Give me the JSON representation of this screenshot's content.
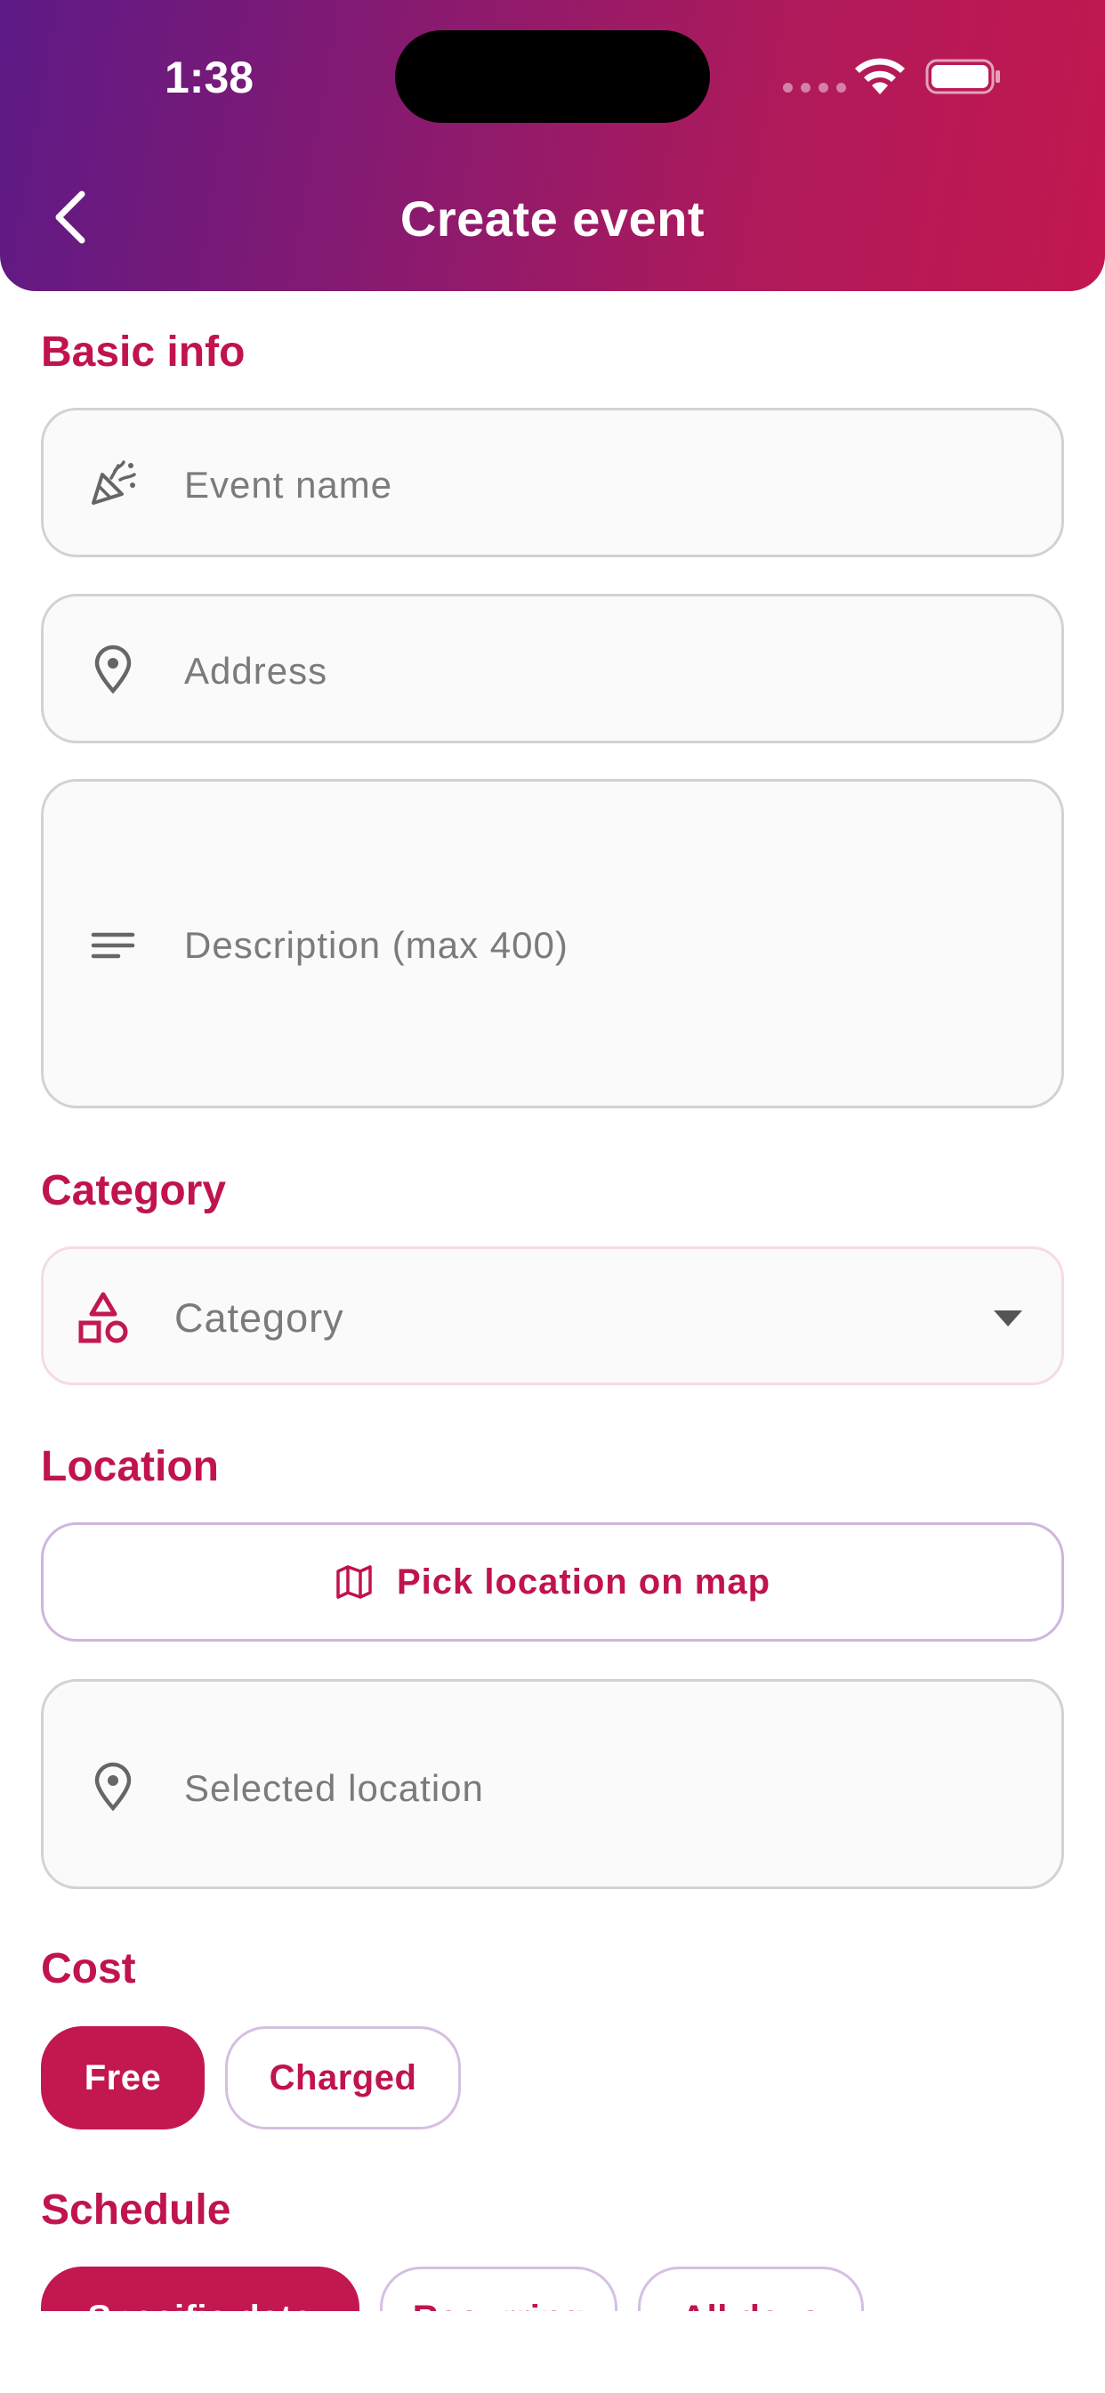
{
  "status_bar": {
    "time": "1:38"
  },
  "header": {
    "title": "Create event"
  },
  "sections": {
    "basic_info": "Basic info",
    "category": "Category",
    "location": "Location",
    "cost": "Cost",
    "schedule": "Schedule"
  },
  "fields": {
    "event_name": {
      "placeholder": "Event name",
      "icon": "party-popper-icon"
    },
    "address": {
      "placeholder": "Address",
      "icon": "location-pin-icon"
    },
    "description": {
      "placeholder": "Description (max 400)",
      "icon": "notes-lines-icon"
    },
    "category": {
      "placeholder": "Category",
      "icon": "shapes-icon"
    },
    "selected_location": {
      "placeholder": "Selected location",
      "icon": "location-pin-icon"
    }
  },
  "location": {
    "pick_button": "Pick location on map",
    "icon": "map-icon"
  },
  "cost": {
    "options": [
      {
        "label": "Free",
        "selected": true
      },
      {
        "label": "Charged",
        "selected": false
      }
    ]
  },
  "schedule": {
    "options": [
      {
        "label": "Specific date",
        "selected": true
      },
      {
        "label": "Recurring",
        "selected": false
      },
      {
        "label": "All days",
        "selected": false
      }
    ]
  },
  "colors": {
    "accent": "#c3174f",
    "header_start": "#5d1a86",
    "header_end": "#c3174f"
  }
}
